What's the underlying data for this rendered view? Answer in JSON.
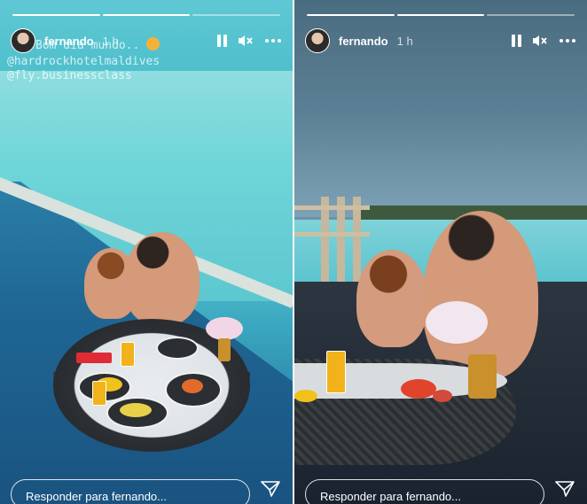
{
  "stories": [
    {
      "username": "fernando",
      "time": "1 h",
      "caption_lines": [
        "Bom dia mundo..",
        "@hardrockhotelmaldives",
        "@fly.businessclass"
      ],
      "reply_placeholder": "Responder para fernando...",
      "progress": {
        "segments": 3,
        "completed": 2
      }
    },
    {
      "username": "fernando",
      "time": "1 h",
      "caption_lines": [],
      "reply_placeholder": "Responder para fernando...",
      "progress": {
        "segments": 3,
        "completed": 2
      }
    }
  ],
  "icons": {
    "pause": "pause-icon",
    "mute": "speaker-muted-icon",
    "more": "more-horizontal-icon",
    "send": "paper-plane-icon"
  }
}
